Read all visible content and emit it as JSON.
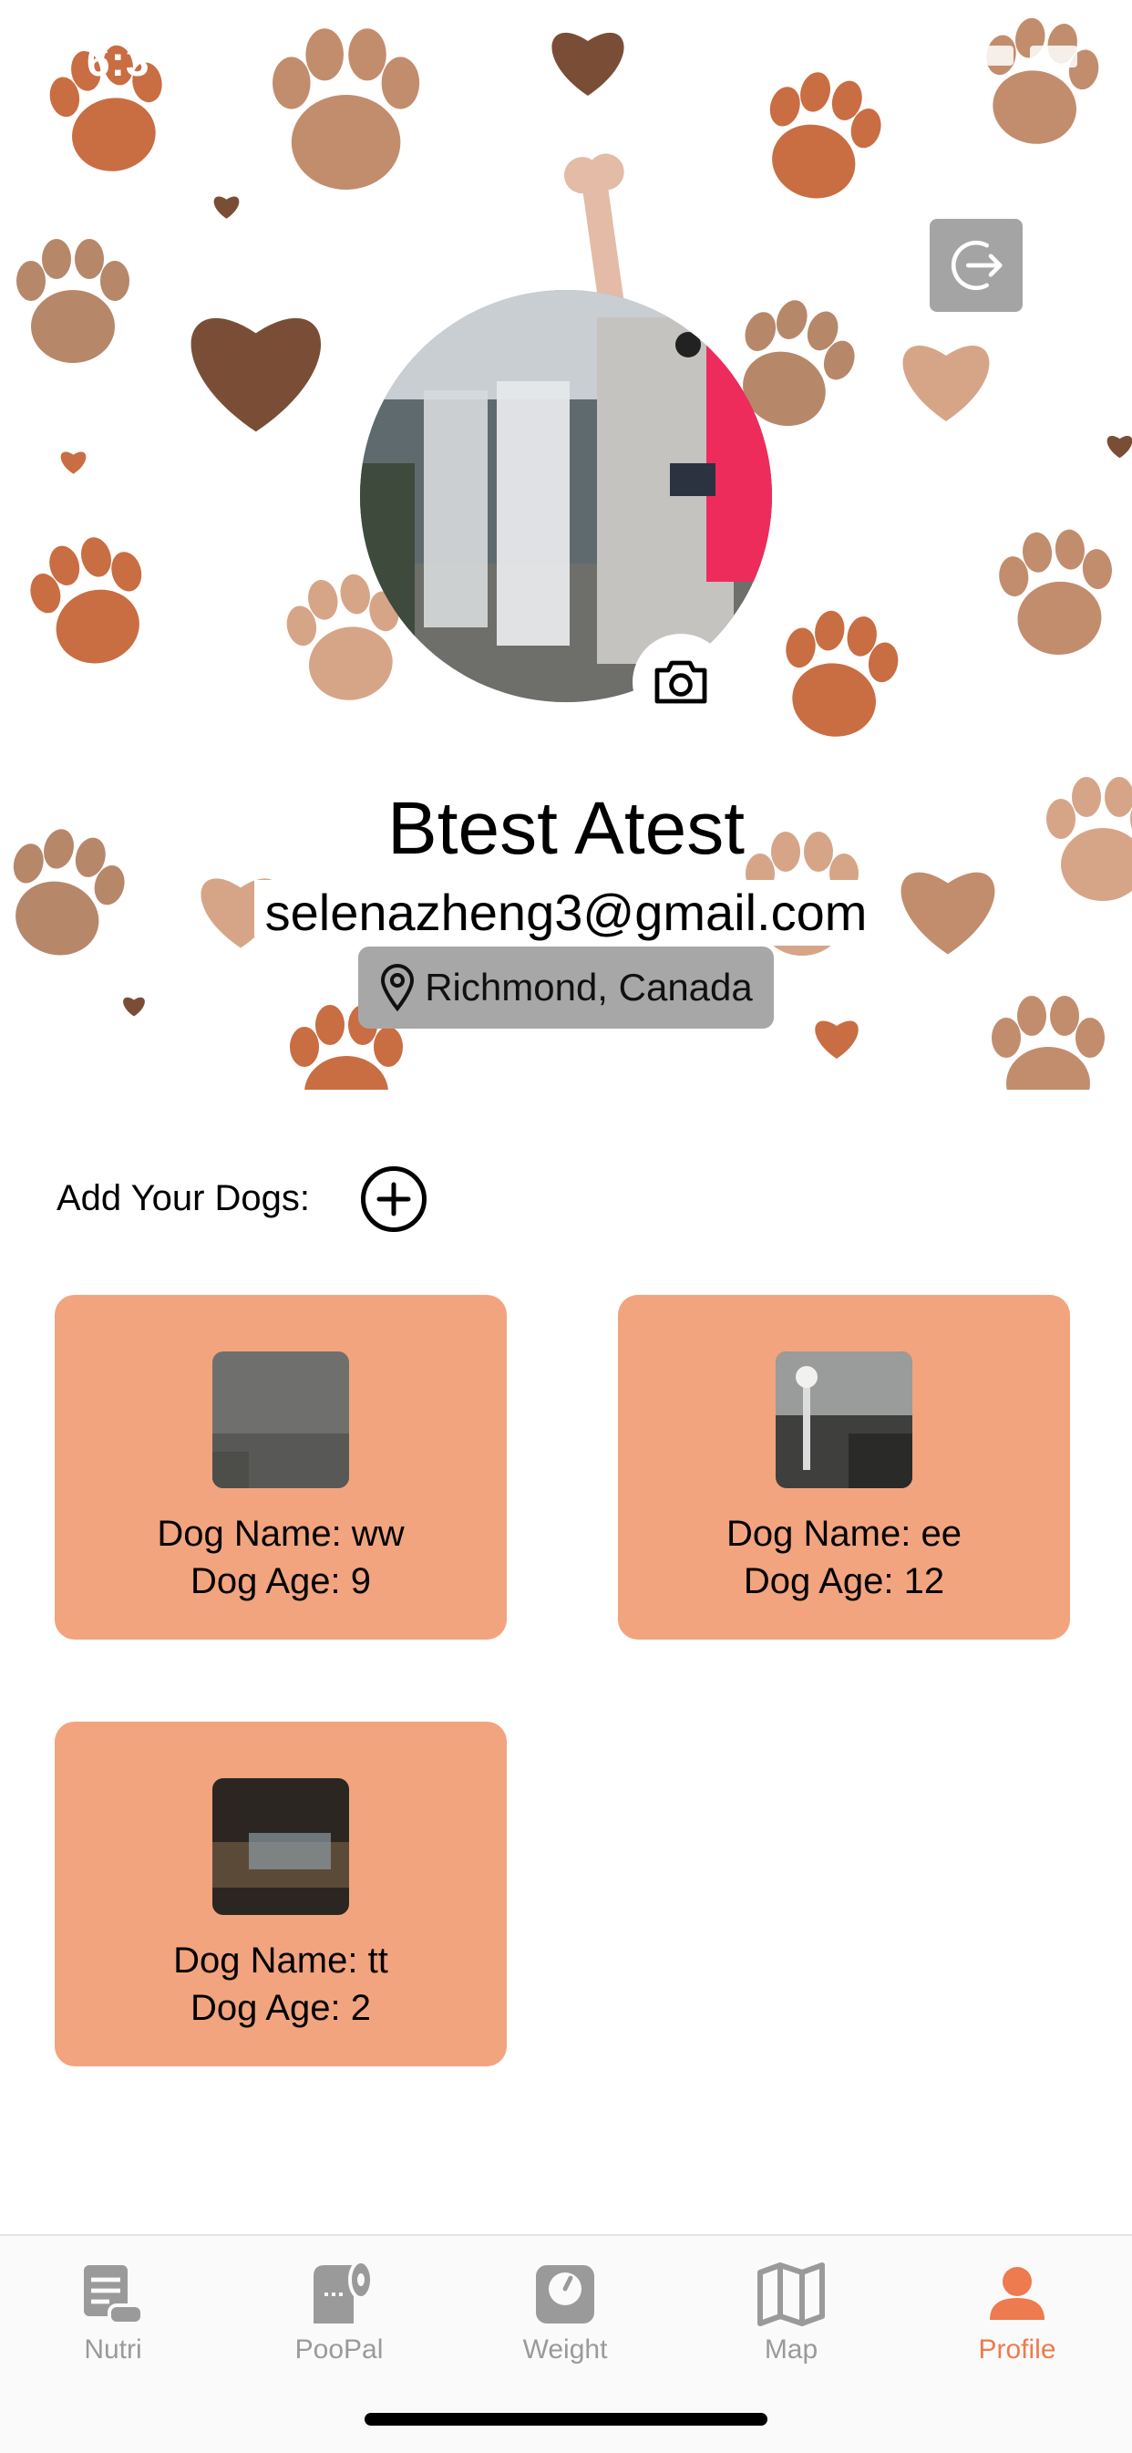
{
  "status_bar": {
    "time": "6:3"
  },
  "profile": {
    "name": "Btest  Atest",
    "email": "selenazheng3@gmail.com",
    "location": "Richmond, Canada"
  },
  "dogs_section": {
    "label": "Add Your Dogs:"
  },
  "dogs": [
    {
      "name": "Dog Name: ww",
      "age": "Dog Age: 9"
    },
    {
      "name": "Dog Name: ee",
      "age": "Dog Age: 12"
    },
    {
      "name": "Dog Name: tt",
      "age": "Dog Age: 2"
    }
  ],
  "tabs": [
    {
      "label": "Nutri",
      "icon": "nutri-icon"
    },
    {
      "label": "PooPal",
      "icon": "poopal-icon"
    },
    {
      "label": "Weight",
      "icon": "weight-scale-icon"
    },
    {
      "label": "Map",
      "icon": "map-icon"
    },
    {
      "label": "Profile",
      "icon": "person-icon",
      "active": true
    }
  ],
  "colors": {
    "accent": "#ee7a4f",
    "card_bg": "#f2a47f",
    "badge_bg": "#a7a7a7",
    "logout_bg": "#a4a4a4",
    "paw_dark": "#c96d43",
    "paw_mid": "#b7876a",
    "paw_light": "#d6a588",
    "heart_dark": "#7a4e36"
  }
}
